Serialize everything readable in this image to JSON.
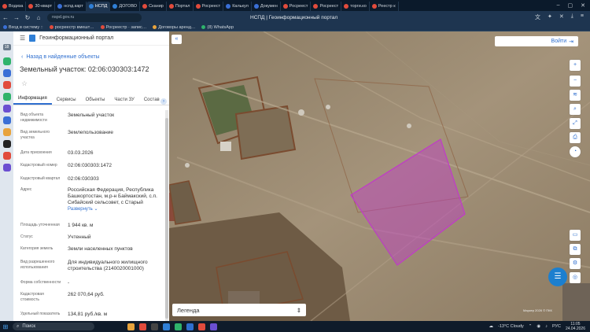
{
  "browser": {
    "tabs": [
      {
        "label": "Водиза",
        "color": "#e14b3c"
      },
      {
        "label": "30-кварт",
        "color": "#e14b3c"
      },
      {
        "label": "нспд.карт",
        "color": "#3a6fd6"
      },
      {
        "label": "НСПД",
        "color": "#2f7fd6",
        "active": true
      },
      {
        "label": "ДОГОВО",
        "color": "#2f7fd6"
      },
      {
        "label": "Сканир",
        "color": "#e14b3c"
      },
      {
        "label": "Портал",
        "color": "#e14b3c"
      },
      {
        "label": "Росреест",
        "color": "#e14b3c"
      },
      {
        "label": "Калькул",
        "color": "#3a6fd6"
      },
      {
        "label": "Докумен",
        "color": "#3a6fd6"
      },
      {
        "label": "Росреест",
        "color": "#e14b3c"
      },
      {
        "label": "Росреест",
        "color": "#e14b3c"
      },
      {
        "label": "торги.ко",
        "color": "#e14b3c"
      },
      {
        "label": "Реестр к",
        "color": "#e14b3c"
      }
    ],
    "url": "nspd.gov.ru",
    "page_title": "НСПД | Геоинформационный портал",
    "bookmarks": [
      {
        "label": "Вход в систему ::",
        "color": "#3a6fd6"
      },
      {
        "label": "росреестр вмешт…",
        "color": "#e14b3c"
      },
      {
        "label": "Росреестр · запис…",
        "color": "#e14b3c"
      },
      {
        "label": "Договоры аренд…",
        "color": "#e8a33c"
      },
      {
        "label": "(8) WhatsApp",
        "color": "#2fb36b"
      }
    ]
  },
  "os_sidebar": {
    "badge": "18"
  },
  "panel": {
    "portal_name": "Геоинформационный портал",
    "back_label": "Назад в найденные объекты",
    "title": "Земельный участок: 02:06:030303:1472",
    "tabs": [
      {
        "label": "Информация",
        "active": true
      },
      {
        "label": "Сервисы"
      },
      {
        "label": "Объекты"
      },
      {
        "label": "Части ЗУ"
      },
      {
        "label": "Состав"
      }
    ],
    "fields": [
      {
        "label": "Вид объекта недвижимости",
        "value": "Земельный участок"
      },
      {
        "label": "Вид земельного участка",
        "value": "Землепользование"
      },
      {
        "label": "Дата присвоения",
        "value": "03.03.2026"
      },
      {
        "label": "Кадастровый номер",
        "value": "02:06:030303:1472"
      },
      {
        "label": "Кадастровый квартал",
        "value": "02:06:030303"
      },
      {
        "label": "Адрес",
        "value": "Российская Федерация, Республика Башкортостан, м.р-н Баймакский, с.п. Сибайский сельсовет, с Старый",
        "more": "Развернуть"
      },
      {
        "label": "Площадь уточненная",
        "value": "1 944 кв. м"
      },
      {
        "label": "Статус",
        "value": "Учтенный"
      },
      {
        "label": "Категория земель",
        "value": "Земли населенных пунктов"
      },
      {
        "label": "Вид разрешенного использования",
        "value": "Для индивидуального жилищного строительства (2140020001000)"
      },
      {
        "label": "Форма собственности",
        "value": "-"
      },
      {
        "label": "Кадастровая стоимость",
        "value": "262 070,64 руб."
      },
      {
        "label": "Удельный показатель",
        "value": "134,81 руб./кв. м"
      }
    ]
  },
  "map": {
    "login_label": "Войти",
    "legend_label": "Легенда",
    "copyright": "Маркер 2026 © ПКК",
    "parcel_color": "#c03bc8"
  },
  "taskbar": {
    "search_placeholder": "Поиск",
    "weather": "-13°C Cloudy",
    "lang": "РУС",
    "time": "11:05",
    "date": "24.04.2026"
  }
}
